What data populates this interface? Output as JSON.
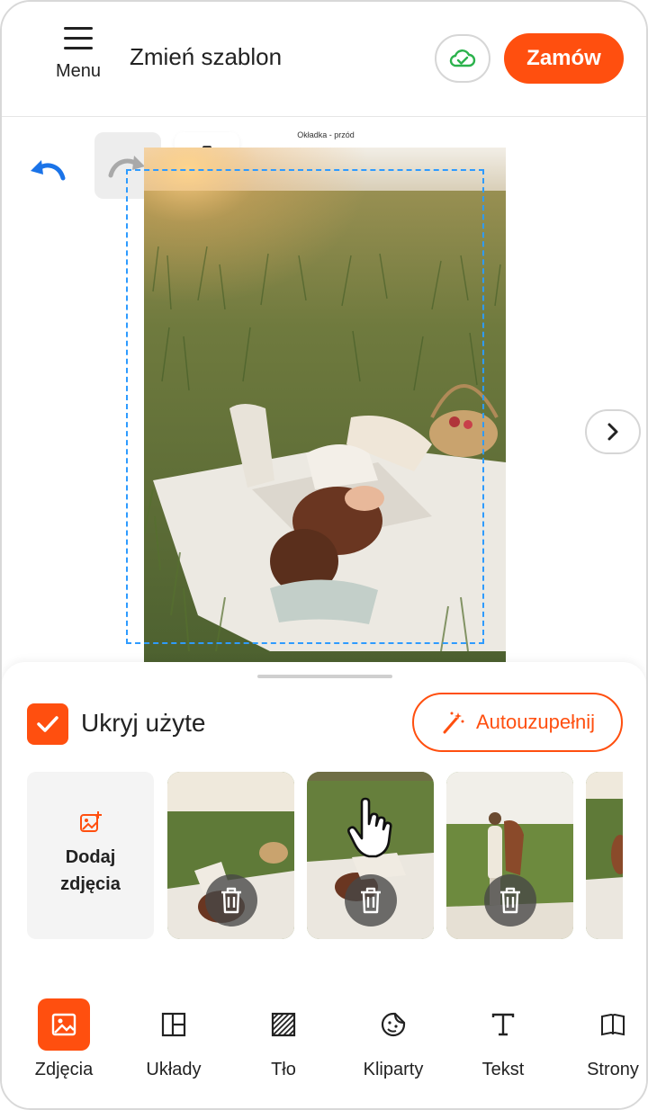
{
  "header": {
    "menu_label": "Menu",
    "change_template": "Zmień szablon",
    "order_label": "Zamów",
    "cloud_icon": "cloud-check-icon"
  },
  "canvas": {
    "page_label": "Okładka - przód",
    "undo_icon": "undo-icon",
    "redo_icon": "redo-icon",
    "settings_icon": "gear-icon",
    "next_icon": "chevron-right-icon"
  },
  "sheet": {
    "hide_used_label": "Ukryj użyte",
    "hide_used_checked": true,
    "autofill_label": "Autouzupełnij",
    "add_photos_label": "Dodaj zdjęcia",
    "thumbnails": [
      {
        "name": "photo-1"
      },
      {
        "name": "photo-2"
      },
      {
        "name": "photo-3"
      },
      {
        "name": "photo-4"
      }
    ]
  },
  "nav": {
    "items": [
      {
        "label": "Zdjęcia",
        "icon": "image-icon",
        "active": true
      },
      {
        "label": "Układy",
        "icon": "layout-icon",
        "active": false
      },
      {
        "label": "Tło",
        "icon": "background-icon",
        "active": false
      },
      {
        "label": "Kliparty",
        "icon": "sticker-icon",
        "active": false
      },
      {
        "label": "Tekst",
        "icon": "text-icon",
        "active": false
      },
      {
        "label": "Strony",
        "icon": "book-icon",
        "active": false
      }
    ]
  },
  "colors": {
    "accent": "#ff4f0f",
    "selection": "#2e9bff",
    "undo": "#1a73e8",
    "cloud_ok": "#2bb24c"
  }
}
